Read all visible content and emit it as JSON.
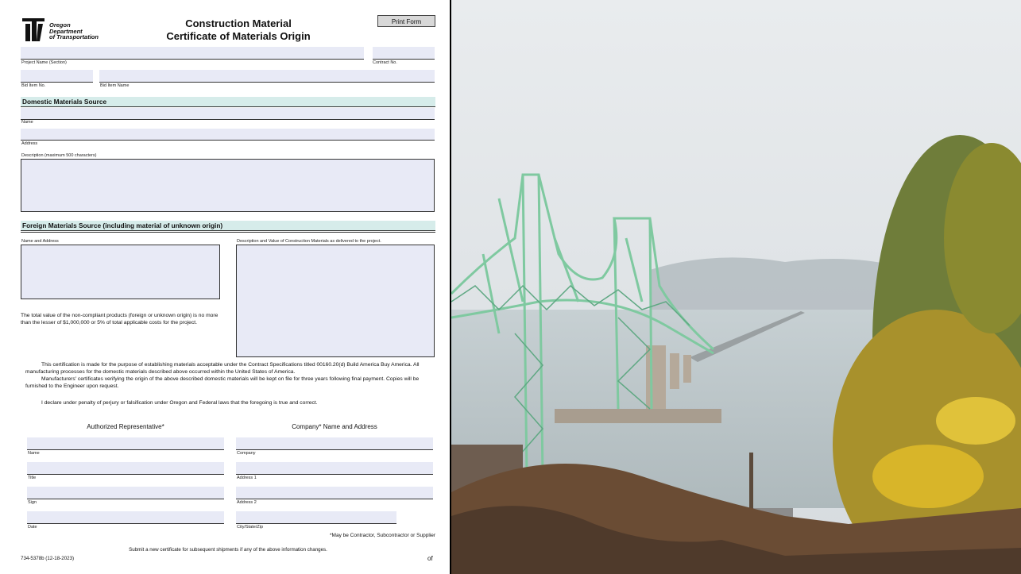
{
  "header": {
    "logo_line1": "Oregon",
    "logo_line2": "Department",
    "logo_line3": "of Transportation",
    "title_line1": "Construction Material",
    "title_line2": "Certificate of Materials Origin",
    "print_button": "Print Form"
  },
  "project": {
    "project_name_label": "Project Name (Section)",
    "contract_label": "Contract No.",
    "bid_item_no_label": "Bid Item No.",
    "bid_item_name_label": "Bid Item Name"
  },
  "domestic": {
    "heading": "Domestic Materials Source",
    "name_label": "Name",
    "address_label": "Address",
    "description_label": "Description (maximum 500 characters)"
  },
  "foreign": {
    "heading": "Foreign Materials Source (including material of unknown origin)",
    "name_address_label": "Name and Address",
    "description_label": "Description and Value of Construction Materials as delivered to the project.",
    "total_value_text": "The total value of the non-compliant products (foreign or unknown origin) is no more than the lesser of $1,000,000 or 5% of total applicable costs for the project."
  },
  "certification": {
    "para1": "This certification is made for the purpose of establishing materials acceptable under the Contract Specifications titled 00160.20(d) Build America Buy America. All manufacturing processes for the domestic materials described above occurred within the United States of America.",
    "para2": "Manufacturers' certificates verifying the origin of the above described domestic materials will be kept on file for three years following final payment. Copies will be furnished to the Engineer upon request.",
    "declaration": "I declare under penalty of perjury or falsification under Oregon and Federal laws that the foregoing is true and correct."
  },
  "signature": {
    "rep_heading": "Authorized Representative*",
    "company_heading": "Company* Name and Address",
    "name_label": "Name",
    "title_label": "Title",
    "sign_label": "Sign",
    "date_label": "Date",
    "company_label": "Company",
    "address1_label": "Address 1",
    "address2_label": "Address 2",
    "city_label": "City/State/Zip",
    "footnote": "*May be Contractor, Subcontractor or Supplier"
  },
  "footer": {
    "submit_note": "Submit a new certificate for subsequent shipments if any of the above information changes.",
    "form_id": "734-5378b (12-18-2023)",
    "of_label": "of"
  },
  "colors": {
    "field_fill": "#e8eaf6",
    "section_band": "#d6ecea",
    "bridge_green": "#7fc9a0"
  }
}
